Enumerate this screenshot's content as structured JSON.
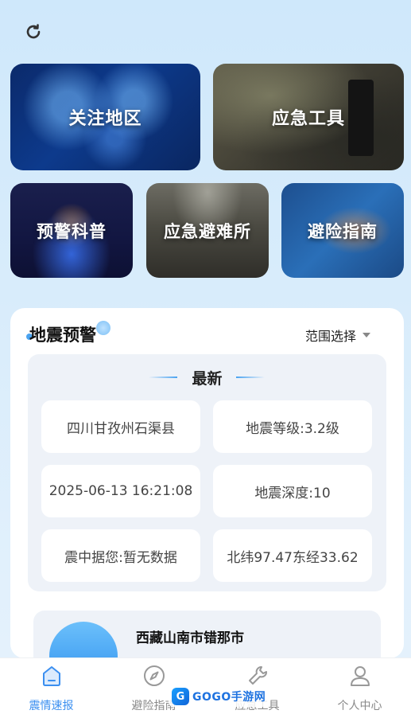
{
  "tiles": {
    "region": "关注地区",
    "tools": "应急工具",
    "warning": "预警科普",
    "shelter": "应急避难所",
    "guide": "避险指南"
  },
  "quake": {
    "title": "地震预警",
    "range_select": "范围选择",
    "latest_label": "最新",
    "location": "四川甘孜州石渠县",
    "magnitude": "地震等级:3.2级",
    "time": "2025-06-13 16:21:08",
    "depth": "地震深度:10",
    "distance": "震中据您:暂无数据",
    "coords": "北纬97.47东经33.62",
    "next_item_title": "西藏山南市错那市"
  },
  "tabs": [
    {
      "label": "震情速报",
      "icon": "home-icon",
      "active": true
    },
    {
      "label": "避险指南",
      "icon": "compass-icon",
      "active": false
    },
    {
      "label": "应急工具",
      "icon": "wrench-icon",
      "active": false
    },
    {
      "label": "个人中心",
      "icon": "user-icon",
      "active": false
    }
  ],
  "watermark": {
    "logo": "G",
    "text": "GOGO手游网"
  },
  "colors": {
    "accent": "#3b8ff0",
    "inactive": "#888888"
  }
}
